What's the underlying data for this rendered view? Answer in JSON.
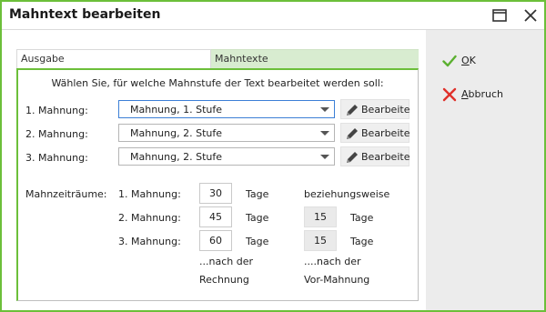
{
  "window": {
    "title": "Mahntext bearbeiten"
  },
  "tabs": [
    {
      "label": "Ausgabe"
    },
    {
      "label": "Mahntexte"
    }
  ],
  "prompt": "Wählen Sie, für welche Mahnstufe der Text bearbeitet werden soll:",
  "rows": [
    {
      "label": "1. Mahnung:",
      "value": "Mahnung, 1. Stufe",
      "button": "Bearbeite"
    },
    {
      "label": "2. Mahnung:",
      "value": "Mahnung, 2. Stufe",
      "button": "Bearbeite"
    },
    {
      "label": "3. Mahnung:",
      "value": "Mahnung, 2. Stufe",
      "button": "Bearbeite"
    }
  ],
  "periods": {
    "label": "Mahnzeiträume:",
    "unit": "Tage",
    "respectively": "beziehungsweise",
    "items": [
      {
        "label": "1. Mahnung:",
        "days": "30"
      },
      {
        "label": "2. Mahnung:",
        "days": "45",
        "days_after_prev": "15"
      },
      {
        "label": "3. Mahnung:",
        "days": "60",
        "days_after_prev": "15"
      }
    ],
    "note_invoice_line1": "...nach der",
    "note_invoice_line2": "Rechnung",
    "note_prev_line1": "....nach der",
    "note_prev_line2": "Vor-Mahnung"
  },
  "actions": {
    "ok_first": "O",
    "ok_rest": "K",
    "cancel_first": "A",
    "cancel_rest": "bbruch"
  },
  "colors": {
    "accent": "#6cbf3a",
    "tab_active": "#d8ecd0",
    "cancel": "#e0302a"
  }
}
